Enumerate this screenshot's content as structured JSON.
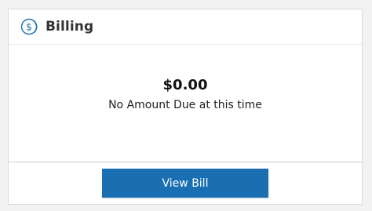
{
  "colors": {
    "accent": "#1a6fb2",
    "icon": "#1a6fb2"
  },
  "header": {
    "icon": "dollar-coin-icon",
    "title": "Billing"
  },
  "body": {
    "amount": "$0.00",
    "note": "No Amount Due at this time"
  },
  "footer": {
    "button_label": "View Bill"
  }
}
